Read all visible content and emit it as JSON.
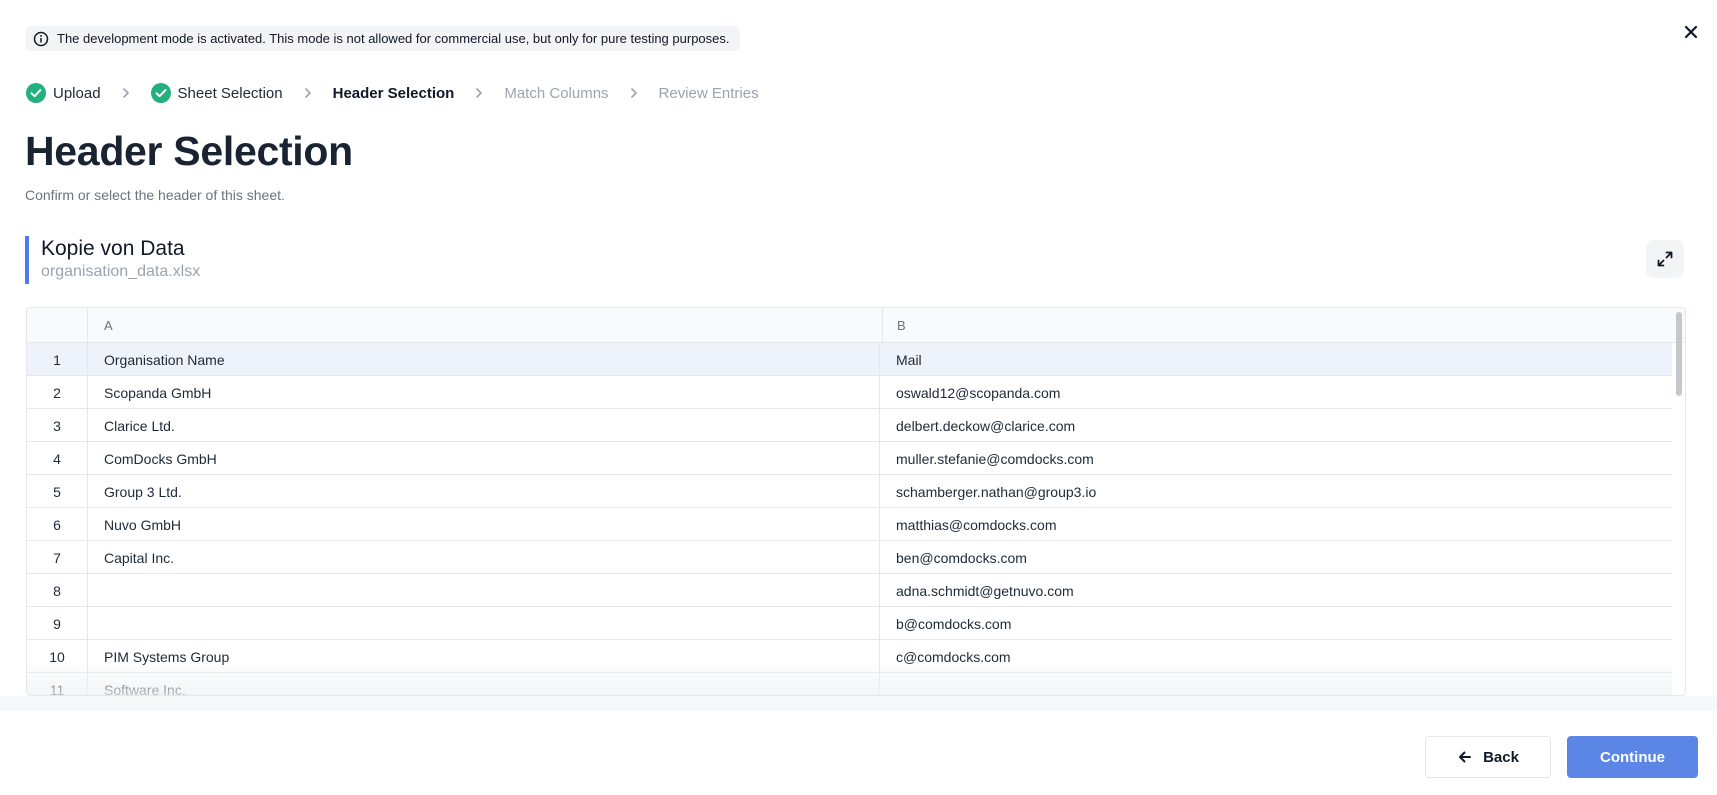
{
  "banner": {
    "icon": "info-icon",
    "text": "The development mode is activated. This mode is not allowed for commercial use, but only for pure testing purposes."
  },
  "stepper": {
    "steps": [
      {
        "label": "Upload",
        "state": "done"
      },
      {
        "label": "Sheet Selection",
        "state": "done"
      },
      {
        "label": "Header Selection",
        "state": "active"
      },
      {
        "label": "Match Columns",
        "state": "pending"
      },
      {
        "label": "Review Entries",
        "state": "pending"
      }
    ]
  },
  "page": {
    "title": "Header Selection",
    "subtitle": "Confirm or select the header of this sheet."
  },
  "sheet": {
    "name": "Kopie von Data",
    "file": "organisation_data.xlsx"
  },
  "table": {
    "columns": [
      "A",
      "B"
    ],
    "rows": [
      {
        "num": "1",
        "a": "Organisation Name",
        "b": "Mail",
        "selected": true
      },
      {
        "num": "2",
        "a": "Scopanda GmbH",
        "b": "oswald12@scopanda.com"
      },
      {
        "num": "3",
        "a": "Clarice Ltd.",
        "b": "delbert.deckow@clarice.com"
      },
      {
        "num": "4",
        "a": "ComDocks GmbH",
        "b": "muller.stefanie@comdocks.com"
      },
      {
        "num": "5",
        "a": "Group 3 Ltd.",
        "b": "schamberger.nathan@group3.io"
      },
      {
        "num": "6",
        "a": "Nuvo GmbH",
        "b": "matthias@comdocks.com"
      },
      {
        "num": "7",
        "a": "Capital Inc.",
        "b": "ben@comdocks.com"
      },
      {
        "num": "8",
        "a": "",
        "b": "adna.schmidt@getnuvo.com"
      },
      {
        "num": "9",
        "a": "",
        "b": "b@comdocks.com"
      },
      {
        "num": "10",
        "a": "PIM Systems Group",
        "b": "c@comdocks.com"
      },
      {
        "num": "11",
        "a": "Software Inc.",
        "b": ""
      }
    ]
  },
  "footer": {
    "back_label": "Back",
    "continue_label": "Continue"
  },
  "colors": {
    "accent": "#5b86e5",
    "success": "#22b07d",
    "sheet_bar": "#4f7ae8",
    "selected_row": "#eef2fa"
  }
}
